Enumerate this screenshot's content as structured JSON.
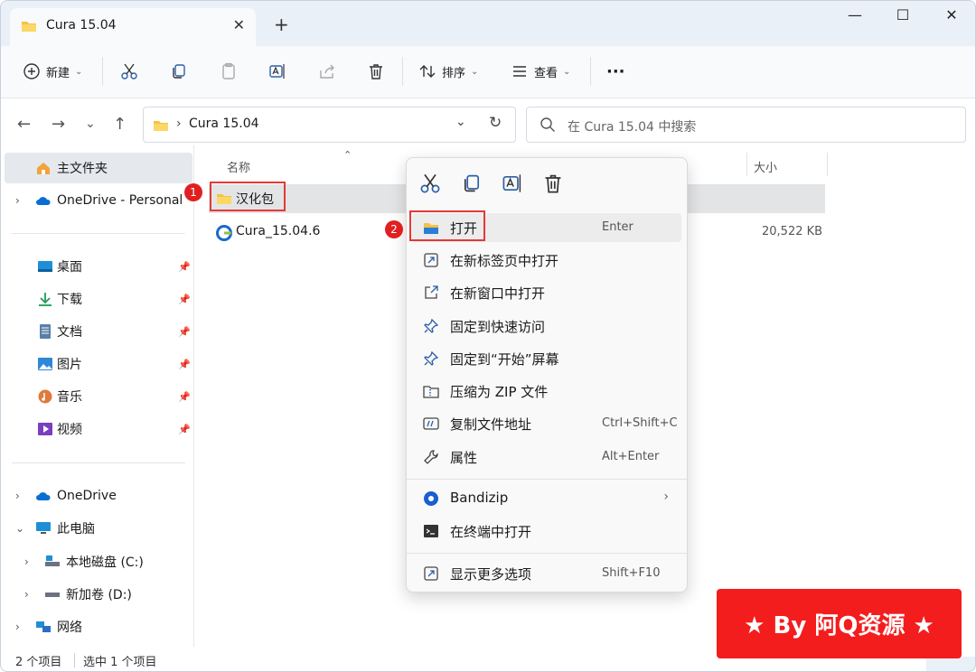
{
  "window": {
    "tab_title": "Cura 15.04",
    "close_tab": "✕",
    "new_tab": "+",
    "minimize": "—",
    "maximize": "☐",
    "close": "✕"
  },
  "toolbar": {
    "new_label": "新建",
    "sort_label": "排序",
    "view_label": "查看",
    "more": "···"
  },
  "address": {
    "path": "Cura 15.04",
    "search_placeholder": "在 Cura 15.04 中搜索"
  },
  "sidebar": {
    "home": "主文件夹",
    "onedrive_personal": "OneDrive - Personal",
    "quick": [
      {
        "label": "桌面"
      },
      {
        "label": "下载"
      },
      {
        "label": "文档"
      },
      {
        "label": "图片"
      },
      {
        "label": "音乐"
      },
      {
        "label": "视频"
      }
    ],
    "onedrive": "OneDrive",
    "this_pc": "此电脑",
    "drive_c": "本地磁盘 (C:)",
    "drive_d": "新加卷 (D:)",
    "network": "网络"
  },
  "columns": {
    "name": "名称",
    "size": "大小"
  },
  "files": [
    {
      "name": "汉化包",
      "size": ""
    },
    {
      "name": "Cura_15.04.6",
      "size": "20,522 KB"
    }
  ],
  "status": {
    "count": "2 个项目",
    "selected": "选中 1 个项目"
  },
  "context_menu": {
    "items": [
      {
        "label": "打开",
        "shortcut": "Enter"
      },
      {
        "label": "在新标签页中打开",
        "shortcut": ""
      },
      {
        "label": "在新窗口中打开",
        "shortcut": ""
      },
      {
        "label": "固定到快速访问",
        "shortcut": ""
      },
      {
        "label": "固定到“开始”屏幕",
        "shortcut": ""
      },
      {
        "label": "压缩为 ZIP 文件",
        "shortcut": ""
      },
      {
        "label": "复制文件地址",
        "shortcut": "Ctrl+Shift+C"
      },
      {
        "label": "属性",
        "shortcut": "Alt+Enter"
      },
      {
        "label": "Bandizip",
        "shortcut": ""
      },
      {
        "label": "在终端中打开",
        "shortcut": ""
      },
      {
        "label": "显示更多选项",
        "shortcut": "Shift+F10"
      }
    ]
  },
  "annotations": {
    "step1": "1",
    "step2": "2"
  },
  "watermark": "★ By 阿Q资源 ★",
  "colors": {
    "accent": "#0067c0",
    "folder": "#f5c242",
    "annotation": "#e53935",
    "watermark_bg": "#f41d1d"
  }
}
